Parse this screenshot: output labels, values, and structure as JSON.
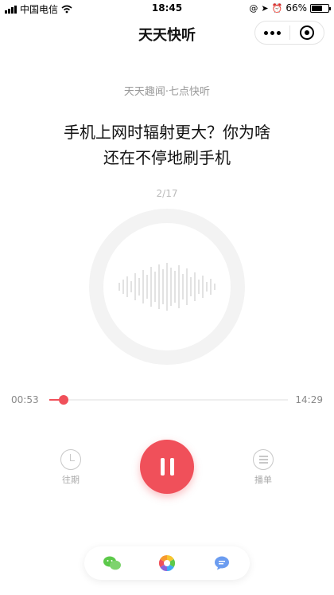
{
  "status_bar": {
    "carrier": "中国电信",
    "time": "18:45",
    "battery": "66%",
    "battery_level": 0.66
  },
  "nav": {
    "title": "天天快听",
    "more_icon": "more-dots-icon",
    "close_icon": "target-circle-icon"
  },
  "article": {
    "source": "天天趣闻·七点快听",
    "title_line1": "手机上网时辐射更大？你为啥",
    "title_line2": "还在不停地刷手机",
    "counter": "2/17"
  },
  "player": {
    "current_time": "00:53",
    "total_time": "14:29",
    "progress": 0.061,
    "history_label": "往期",
    "playlist_label": "播单",
    "play_icon": "pause-icon"
  },
  "share": {
    "items": [
      "wechat-icon",
      "moments-icon",
      "message-icon"
    ]
  },
  "colors": {
    "accent": "#f0505a",
    "muted": "#999999"
  }
}
